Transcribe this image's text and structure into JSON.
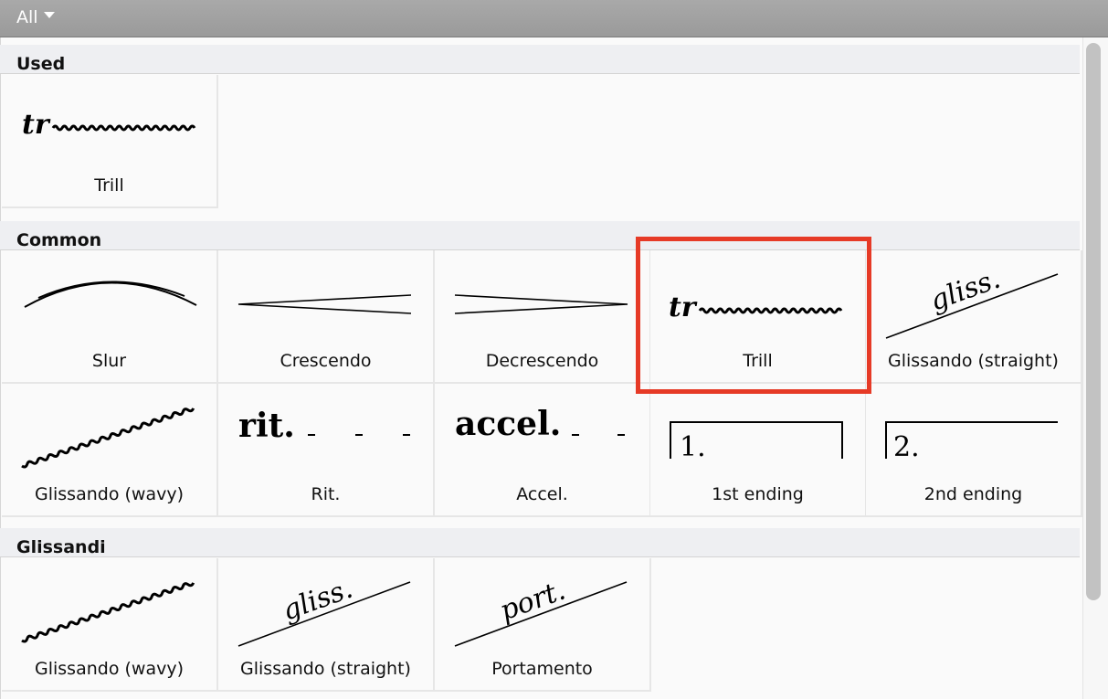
{
  "filter": {
    "label": "All"
  },
  "sections": {
    "used": {
      "title": "Used",
      "items": [
        {
          "label": "Trill",
          "glyph": "tr"
        }
      ]
    },
    "common": {
      "title": "Common",
      "items": [
        {
          "label": "Slur"
        },
        {
          "label": "Crescendo"
        },
        {
          "label": "Decrescendo"
        },
        {
          "label": "Trill",
          "glyph": "tr"
        },
        {
          "label": "Glissando (straight)",
          "glyph": "gliss."
        },
        {
          "label": "Glissando (wavy)"
        },
        {
          "label": "Rit.",
          "glyph": "rit."
        },
        {
          "label": "Accel.",
          "glyph": "accel."
        },
        {
          "label": "1st ending",
          "glyph": "1."
        },
        {
          "label": "2nd ending",
          "glyph": "2."
        }
      ]
    },
    "glissandi": {
      "title": "Glissandi",
      "items": [
        {
          "label": "Glissando (wavy)"
        },
        {
          "label": "Glissando (straight)",
          "glyph": "gliss."
        },
        {
          "label": "Portamento",
          "glyph": "port."
        }
      ]
    }
  },
  "selected": "common-trill",
  "colors": {
    "highlight": "#e63a26",
    "header": "#eeeff2"
  }
}
